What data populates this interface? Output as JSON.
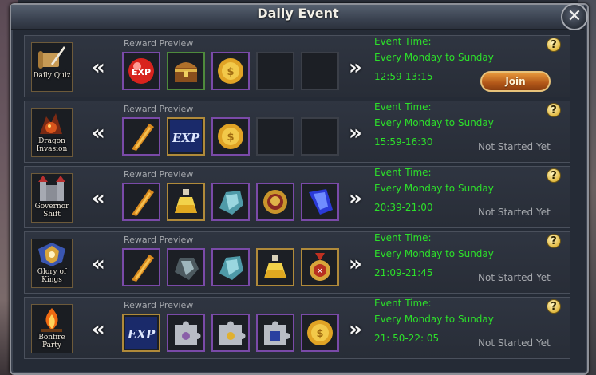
{
  "window": {
    "title": "Daily Event",
    "close_label": "✕"
  },
  "labels": {
    "reward_preview": "Reward Preview",
    "event_time": "Event Time:",
    "help": "?",
    "prev": "«",
    "next": "»"
  },
  "events": [
    {
      "name": "Daily Quiz",
      "days": "Every Monday to Sunday",
      "time": "12:59-13:15",
      "action": "Join",
      "icon": "scroll-quill-icon",
      "rewards": [
        "exp-orb-icon",
        "treasure-chest-icon",
        "gold-coin-icon",
        "empty",
        "empty"
      ]
    },
    {
      "name": "Dragon Invasion",
      "days": "Every Monday to Sunday",
      "time": "15:59-16:30",
      "status": "Not Started Yet",
      "icon": "dragon-icon",
      "rewards": [
        "amber-shard-icon",
        "exp-icon",
        "gold-coin-icon",
        "empty",
        "empty"
      ]
    },
    {
      "name": "Governor Shift",
      "days": "Every Monday to Sunday",
      "time": "20:39-21:00",
      "status": "Not Started Yet",
      "icon": "castle-icon",
      "rewards": [
        "amber-shard-icon",
        "potion-flask-icon",
        "crystal-ore-icon",
        "lion-medal-icon",
        "blue-gem-icon"
      ]
    },
    {
      "name": "Glory of Kings",
      "days": "Every Monday to Sunday",
      "time": "21:09-21:45",
      "status": "Not Started Yet",
      "icon": "crest-icon",
      "rewards": [
        "amber-shard-icon",
        "stone-ore-icon",
        "crystal-ore-icon",
        "potion-flask-icon",
        "medal-icon"
      ]
    },
    {
      "name": "Bonfire Party",
      "days": "Every Monday to Sunday",
      "time": "21: 50-22: 05",
      "status": "Not Started Yet",
      "icon": "bonfire-icon",
      "rewards": [
        "exp-icon",
        "puzzle-piece-icon",
        "puzzle-piece-icon",
        "puzzle-piece-icon",
        "gold-coin-icon"
      ]
    }
  ],
  "colors": {
    "event_time_green": "#2de02a",
    "status_gray": "#a5a8ad",
    "join_orange": "#b25718",
    "help_yellow": "#e2b940"
  }
}
